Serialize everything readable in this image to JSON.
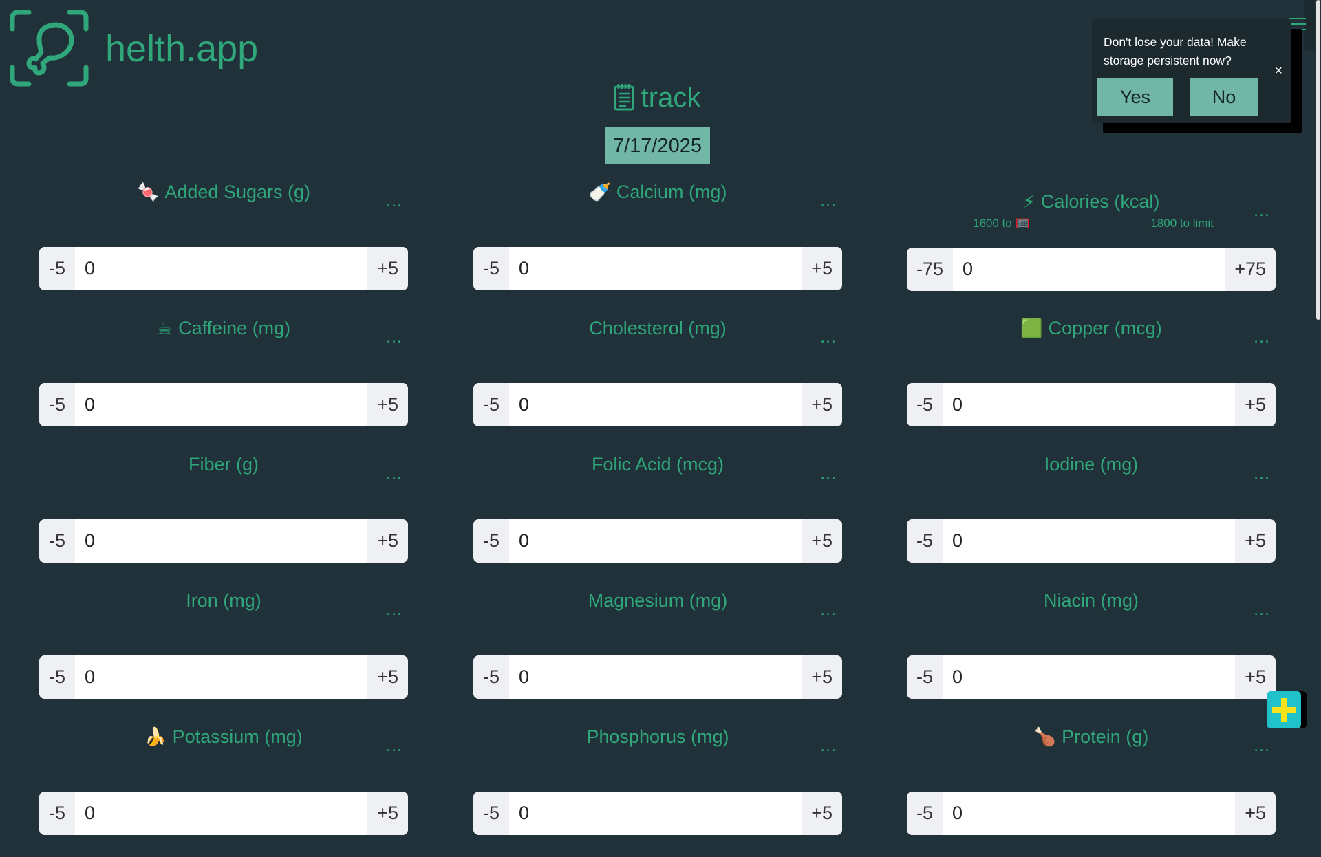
{
  "app": {
    "title": "helth.app"
  },
  "page": {
    "title": "track",
    "title_icon": "notepad-icon",
    "date": "7/17/2025"
  },
  "popup": {
    "message": "Don't lose your data! Make storage persistent now?",
    "close_label": "×",
    "yes_label": "Yes",
    "no_label": "No"
  },
  "fab": {
    "icon": "plus-icon"
  },
  "nutrients": [
    {
      "icon_name": "candy-icon",
      "emoji": "🍬",
      "label": "Added Sugars (g)",
      "more": "...",
      "minus": "-5",
      "value": "0",
      "plus": "+5"
    },
    {
      "icon_name": "milk-bottle-icon",
      "emoji": "🍼",
      "label": "Calcium (mg)",
      "more": "...",
      "minus": "-5",
      "value": "0",
      "plus": "+5"
    },
    {
      "icon_name": "lightning-icon",
      "emoji": "⚡",
      "label": "Calories (kcal)",
      "more": "...",
      "minus": "-75",
      "value": "0",
      "plus": "+75",
      "limit_min": "1600 to 🥅",
      "limit_max": "1800 to limit"
    },
    {
      "icon_name": "coffee-icon",
      "emoji": "☕",
      "label": "Caffeine (mg)",
      "more": "...",
      "minus": "-5",
      "value": "0",
      "plus": "+5"
    },
    {
      "emoji": "",
      "label": "Cholesterol (mg)",
      "more": "...",
      "minus": "-5",
      "value": "0",
      "plus": "+5"
    },
    {
      "icon_name": "green-square-icon",
      "emoji": "🟩",
      "label": "Copper (mcg)",
      "more": "...",
      "minus": "-5",
      "value": "0",
      "plus": "+5"
    },
    {
      "emoji": "",
      "label": "Fiber (g)",
      "more": "...",
      "minus": "-5",
      "value": "0",
      "plus": "+5"
    },
    {
      "emoji": "",
      "label": "Folic Acid (mcg)",
      "more": "...",
      "minus": "-5",
      "value": "0",
      "plus": "+5"
    },
    {
      "emoji": "",
      "label": "Iodine (mg)",
      "more": "...",
      "minus": "-5",
      "value": "0",
      "plus": "+5"
    },
    {
      "emoji": "",
      "label": "Iron (mg)",
      "more": "...",
      "minus": "-5",
      "value": "0",
      "plus": "+5"
    },
    {
      "emoji": "",
      "label": "Magnesium (mg)",
      "more": "...",
      "minus": "-5",
      "value": "0",
      "plus": "+5"
    },
    {
      "emoji": "",
      "label": "Niacin (mg)",
      "more": "...",
      "minus": "-5",
      "value": "0",
      "plus": "+5"
    },
    {
      "icon_name": "banana-icon",
      "emoji": "🍌",
      "label": "Potassium (mg)",
      "more": "...",
      "minus": "-5",
      "value": "0",
      "plus": "+5"
    },
    {
      "emoji": "",
      "label": "Phosphorus (mg)",
      "more": "...",
      "minus": "-5",
      "value": "0",
      "plus": "+5"
    },
    {
      "icon_name": "poultry-leg-icon",
      "emoji": "🍗",
      "label": "Protein (g)",
      "more": "...",
      "minus": "-5",
      "value": "0",
      "plus": "+5"
    }
  ],
  "colors": {
    "background": "#203139",
    "accent": "#2fa77a",
    "button": "#72b6a5",
    "fab": "#21c1c9"
  }
}
